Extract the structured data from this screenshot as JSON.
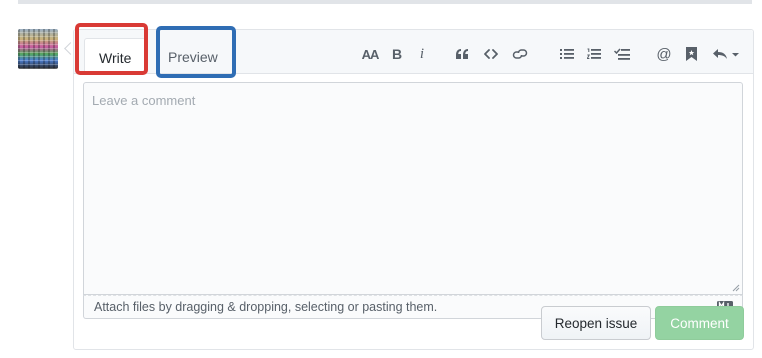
{
  "tabs": {
    "write": "Write",
    "preview": "Preview"
  },
  "toolbar": {
    "header_text": "AA",
    "bold_text": "B",
    "italic_text": "i"
  },
  "editor": {
    "placeholder": "Leave a comment",
    "value": ""
  },
  "attach": {
    "text": "Attach files by dragging & dropping, selecting or pasting them."
  },
  "actions": {
    "reopen_label": "Reopen issue",
    "comment_label": "Comment"
  },
  "colors": {
    "highlight_write": "#d93a35",
    "highlight_preview": "#2f6db4",
    "comment_button": "#94d3a2"
  }
}
